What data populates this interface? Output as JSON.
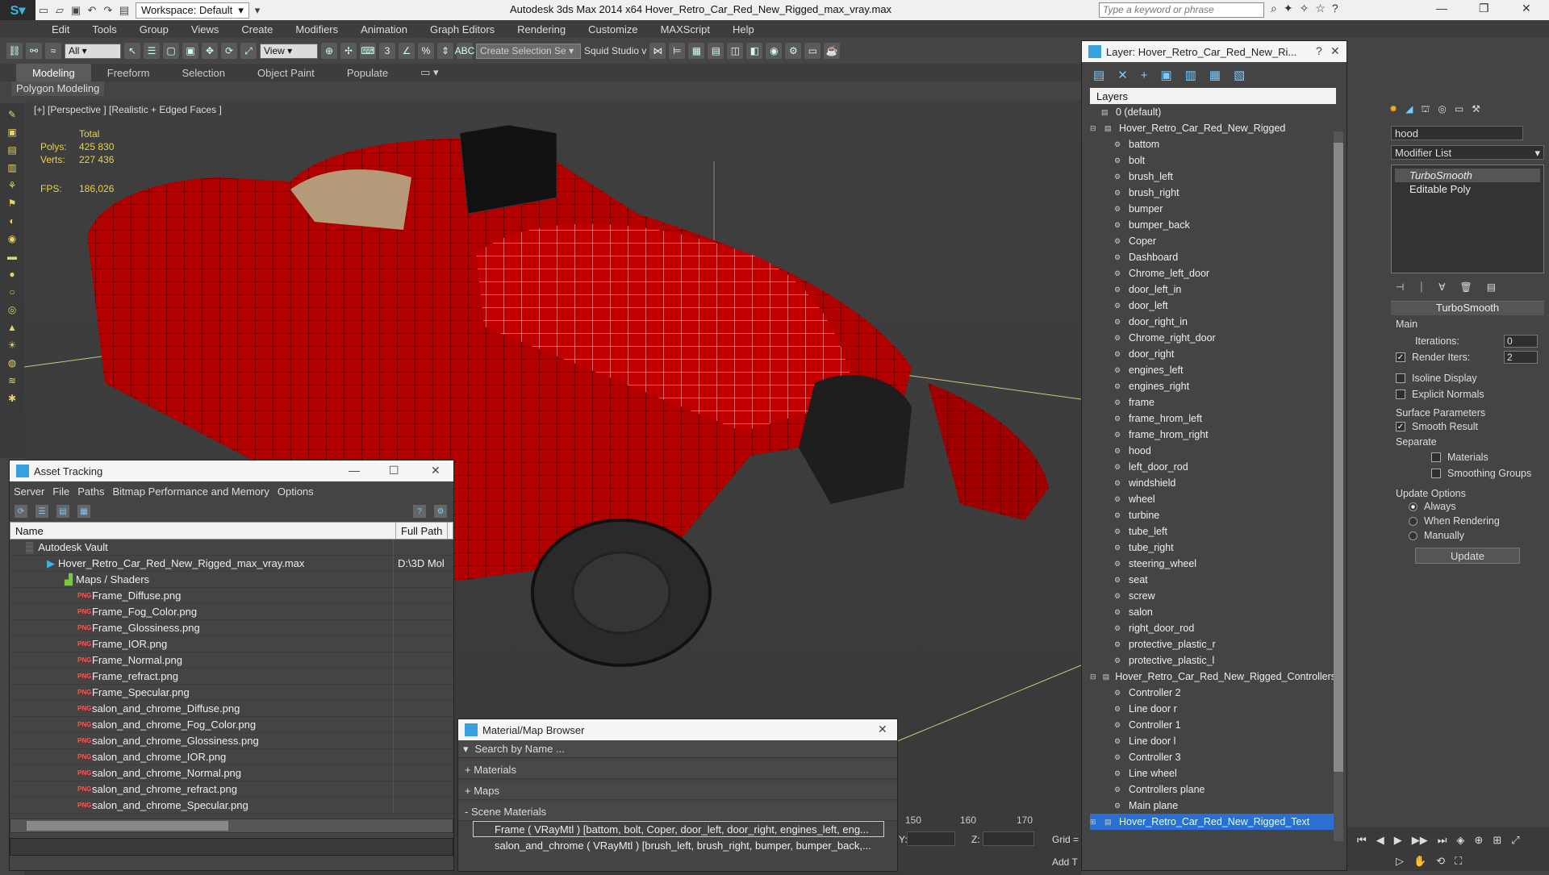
{
  "window": {
    "title": "Autodesk 3ds Max  2014 x64     Hover_Retro_Car_Red_New_Rigged_max_vray.max",
    "workspace": "Workspace: Default",
    "search_placeholder": "Type a keyword or phrase"
  },
  "menu": [
    "Edit",
    "Tools",
    "Group",
    "Views",
    "Create",
    "Modifiers",
    "Animation",
    "Graph Editors",
    "Rendering",
    "Customize",
    "MAXScript",
    "Help"
  ],
  "toolbar": {
    "filter": "All",
    "view": "View",
    "selection_set": "Create Selection Se",
    "studio": "Squid Studio v"
  },
  "ribbon": {
    "tabs": [
      "Modeling",
      "Freeform",
      "Selection",
      "Object Paint",
      "Populate"
    ],
    "subtab": "Polygon Modeling"
  },
  "viewport": {
    "label": "[+] [Perspective ] [Realistic + Edged Faces ]",
    "stats": {
      "total_label": "Total",
      "polys_label": "Polys:",
      "polys": "425 830",
      "verts_label": "Verts:",
      "verts": "227 436",
      "fps_label": "FPS:",
      "fps": "186,026"
    }
  },
  "asset_tracking": {
    "title": "Asset Tracking",
    "menu": [
      "Server",
      "File",
      "Paths",
      "Bitmap Performance and Memory",
      "Options"
    ],
    "columns": [
      "Name",
      "Full Path"
    ],
    "root": "Autodesk Vault",
    "file": "Hover_Retro_Car_Red_New_Rigged_max_vray.max",
    "file_path": "D:\\3D Mol",
    "maps_folder": "Maps / Shaders",
    "maps": [
      "Frame_Diffuse.png",
      "Frame_Fog_Color.png",
      "Frame_Glossiness.png",
      "Frame_IOR.png",
      "Frame_Normal.png",
      "Frame_refract.png",
      "Frame_Specular.png",
      "salon_and_chrome_Diffuse.png",
      "salon_and_chrome_Fog_Color.png",
      "salon_and_chrome_Glossiness.png",
      "salon_and_chrome_IOR.png",
      "salon_and_chrome_Normal.png",
      "salon_and_chrome_refract.png",
      "salon_and_chrome_Specular.png"
    ]
  },
  "material_browser": {
    "title": "Material/Map Browser",
    "search": "Search by Name ...",
    "sections": [
      "+ Materials",
      "+ Maps",
      "- Scene Materials"
    ],
    "items": [
      "Frame  ( VRayMtl ) [battom, bolt, Coper, door_left, door_right, engines_left, eng...",
      "salon_and_chrome  ( VRayMtl ) [brush_left, brush_right, bumper, bumper_back,..."
    ]
  },
  "layer_panel": {
    "title": "Layer: Hover_Retro_Car_Red_New_Ri...",
    "header": "Layers",
    "default": "0 (default)",
    "group1": "Hover_Retro_Car_Red_New_Rigged",
    "items1": [
      "battom",
      "bolt",
      "brush_left",
      "brush_right",
      "bumper",
      "bumper_back",
      "Coper",
      "Dashboard",
      "Chrome_left_door",
      "door_left_in",
      "door_left",
      "door_right_in",
      "Chrome_right_door",
      "door_right",
      "engines_left",
      "engines_right",
      "frame",
      "frame_hrom_left",
      "frame_hrom_right",
      "hood",
      "left_door_rod",
      "windshield",
      "wheel",
      "turbine",
      "tube_left",
      "tube_right",
      "steering_wheel",
      "seat",
      "screw",
      "salon",
      "right_door_rod",
      "protective_plastic_r",
      "protective_plastic_l"
    ],
    "group2": "Hover_Retro_Car_Red_New_Rigged_Controllers",
    "items2": [
      "Controller 2",
      "Line door r",
      "Controller 1",
      "Line door l",
      "Controller 3",
      "Line wheel",
      "Controllers plane",
      "Main plane"
    ],
    "group3": "Hover_Retro_Car_Red_New_Rigged_Text"
  },
  "command_panel": {
    "object_name": "hood",
    "modifier_list": "Modifier List",
    "stack": [
      "TurboSmooth",
      "Editable Poly"
    ],
    "rollout": "TurboSmooth",
    "main": "Main",
    "iterations_label": "Iterations:",
    "iterations": "0",
    "render_iters_label": "Render Iters:",
    "render_iters": "2",
    "isoline": "Isoline Display",
    "explicit": "Explicit Normals",
    "surface_params": "Surface Parameters",
    "smooth_result": "Smooth Result",
    "separate": "Separate",
    "materials": "Materials",
    "smoothing_groups": "Smoothing Groups",
    "update_options": "Update Options",
    "always": "Always",
    "when_rendering": "When Rendering",
    "manually": "Manually",
    "update": "Update"
  },
  "timeline": {
    "ticks": [
      "150",
      "160",
      "170"
    ],
    "y_label": "Y:",
    "z_label": "Z:",
    "grid": "Grid =",
    "add_t": "Add T"
  }
}
